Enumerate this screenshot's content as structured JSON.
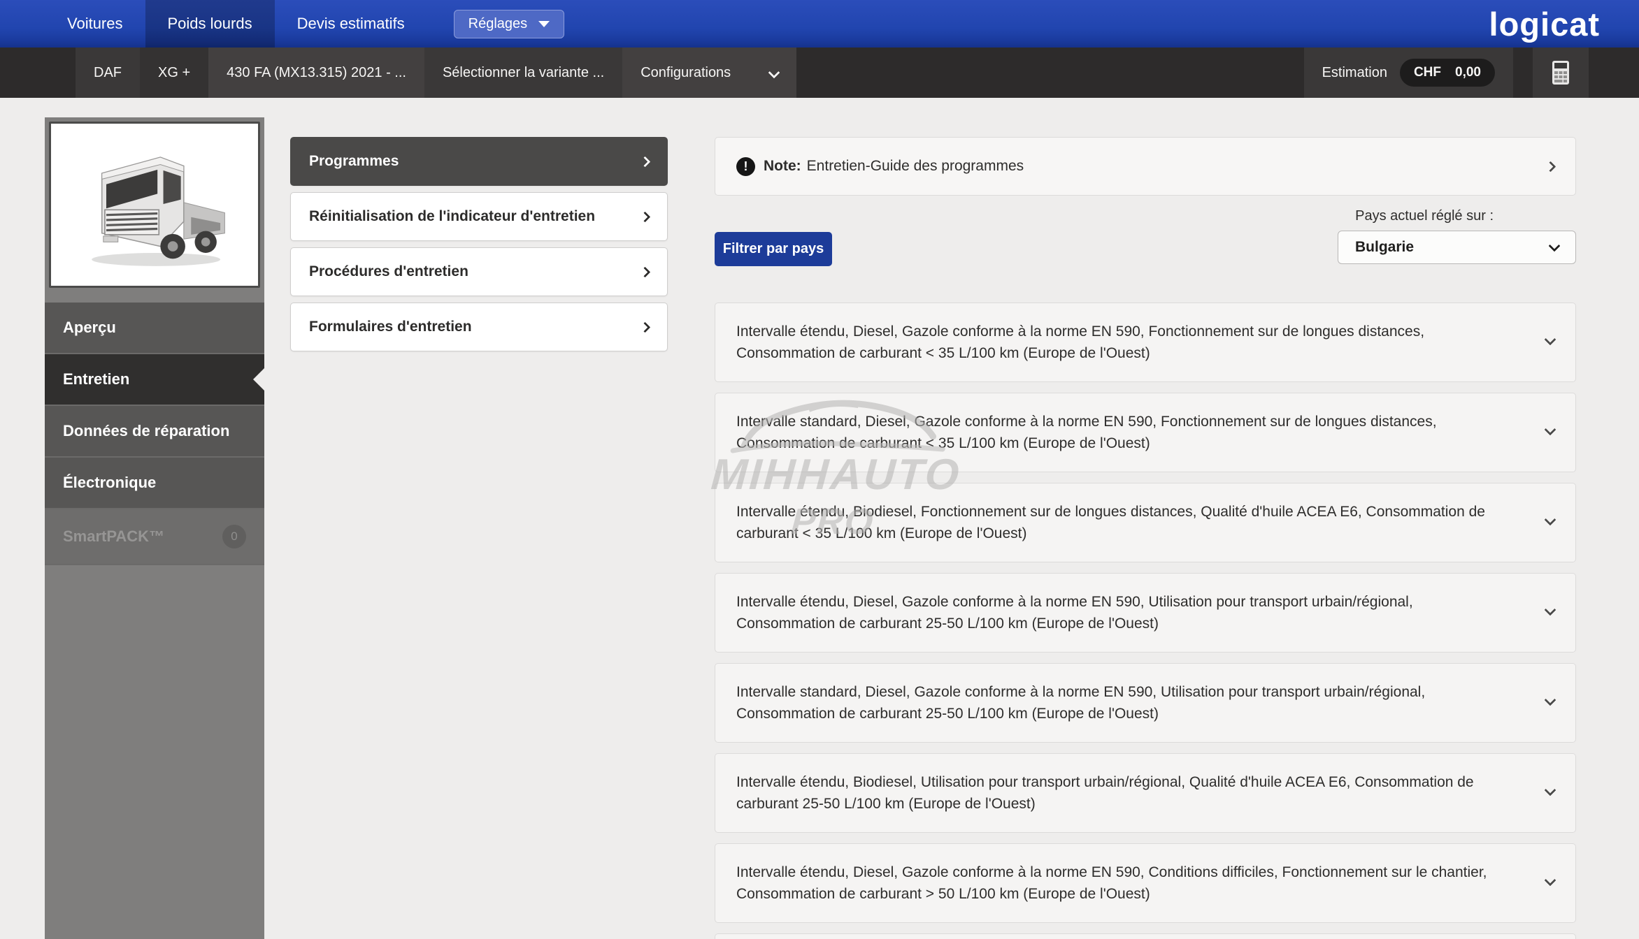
{
  "nav": {
    "tabs": [
      {
        "label": "Voitures"
      },
      {
        "label": "Poids lourds"
      },
      {
        "label": "Devis estimatifs"
      }
    ],
    "settings_label": "Réglages",
    "logo": "logicat"
  },
  "toolbar": {
    "brand": "DAF",
    "model": "XG +",
    "type": "430 FA (MX13.315) 2021 - ...",
    "variant": "Sélectionner la variante ...",
    "configurations": "Configurations",
    "estimation_label": "Estimation",
    "currency": "CHF",
    "amount": "0,00"
  },
  "sidebar": {
    "items": [
      {
        "label": "Aperçu"
      },
      {
        "label": "Entretien"
      },
      {
        "label": "Données de réparation"
      },
      {
        "label": "Électronique"
      },
      {
        "label": "SmartPACK™",
        "badge": "0"
      }
    ]
  },
  "menu": {
    "items": [
      {
        "label": "Programmes"
      },
      {
        "label": "Réinitialisation de l'indicateur d'entretien"
      },
      {
        "label": "Procédures d'entretien"
      },
      {
        "label": "Formulaires d'entretien"
      }
    ]
  },
  "content": {
    "note_label": "Note:",
    "note_text": "Entretien-Guide des programmes",
    "filter_button": "Filtrer par pays",
    "country_label": "Pays actuel réglé sur :",
    "country_value": "Bulgarie",
    "programs": [
      "Intervalle étendu, Diesel, Gazole conforme à la norme EN 590, Fonctionnement sur de longues distances, Consommation de carburant < 35 L/100 km (Europe de l'Ouest)",
      "Intervalle standard, Diesel, Gazole conforme à la norme EN 590, Fonctionnement sur de longues distances, Consommation de carburant < 35 L/100 km (Europe de l'Ouest)",
      "Intervalle étendu, Biodiesel, Fonctionnement sur de longues distances, Qualité d'huile ACEA E6, Consommation de carburant < 35 L/100 km (Europe de l'Ouest)",
      "Intervalle étendu, Diesel, Gazole conforme à la norme EN 590, Utilisation pour transport urbain/régional, Consommation de carburant 25-50 L/100 km (Europe de l'Ouest)",
      "Intervalle standard, Diesel, Gazole conforme à la norme EN 590, Utilisation pour transport urbain/régional, Consommation de carburant 25-50 L/100 km (Europe de l'Ouest)",
      "Intervalle étendu, Biodiesel, Utilisation pour transport urbain/régional, Qualité d'huile ACEA E6, Consommation de carburant 25-50 L/100 km (Europe de l'Ouest)",
      "Intervalle étendu, Diesel, Gazole conforme à la norme EN 590, Conditions difficiles, Fonctionnement sur le chantier, Consommation de carburant > 50 L/100 km (Europe de l'Ouest)"
    ]
  },
  "watermark": {
    "line1": "MIHHAUTO",
    "line2": "PRO"
  },
  "colors": {
    "navbar_blue": "#2145af",
    "settings_button_blue": "#4e69c5",
    "filter_button_blue": "#1d3c99",
    "toolbar_dark": "#2d2b2b",
    "sidebar_gray": "#7f7e7d",
    "active_item_dark": "#302f2e"
  }
}
